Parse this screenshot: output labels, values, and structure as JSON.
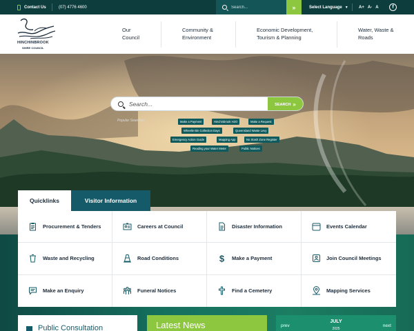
{
  "topbar": {
    "contact_label": "Contact Us",
    "phone": "(07) 4776 4600",
    "search_placeholder": "Search...",
    "search_go": "»",
    "language_label": "Select Language",
    "language_arrow": "▼",
    "text_size_large": "A+",
    "text_size_small": "A-",
    "text_size_reset": "A",
    "facebook": "f"
  },
  "logo": {
    "name": "HINCHINBROOK",
    "sub": "SHIRE COUNCIL"
  },
  "nav": [
    {
      "label": "Our\nCouncil"
    },
    {
      "label": "Community &\nEnvironment"
    },
    {
      "label": "Economic Development,\nTourism & Planning"
    },
    {
      "label": "Water, Waste &\nRoads"
    }
  ],
  "hero": {
    "search_placeholder": "Search...",
    "search_button": "SEARCH",
    "search_button_icon": "»",
    "popular_label": "Popular Searches",
    "chips": [
      "Make a Payment",
      "Hinchinbrook H2O",
      "Make a Request",
      "Wheelie Bin Collection Days",
      "Queensland Waste Levy",
      "Emergency Action Guide",
      "Mapping App",
      "No Stash Zone Register",
      "Reading your Water Meter",
      "Public Notices"
    ]
  },
  "tabs": {
    "quicklinks": "Quicklinks",
    "visitor": "Visitor Information"
  },
  "quicklinks": [
    {
      "label": "Procurement & Tenders",
      "icon": "clipboard-icon"
    },
    {
      "label": "Careers at Council",
      "icon": "id-card-icon"
    },
    {
      "label": "Disaster Information",
      "icon": "document-icon"
    },
    {
      "label": "Events Calendar",
      "icon": "calendar-icon"
    },
    {
      "label": "Waste and Recycling",
      "icon": "bin-icon"
    },
    {
      "label": "Road Conditions",
      "icon": "traffic-cone-icon"
    },
    {
      "label": "Make a Payment",
      "icon": "dollar-icon"
    },
    {
      "label": "Join Council Meetings",
      "icon": "meeting-icon"
    },
    {
      "label": "Make an Enquiry",
      "icon": "chat-icon"
    },
    {
      "label": "Funeral Notices",
      "icon": "people-icon"
    },
    {
      "label": "Find a Cemetery",
      "icon": "cross-icon"
    },
    {
      "label": "Mapping Services",
      "icon": "map-pin-icon"
    }
  ],
  "panels": {
    "consultation_title": "Public Consultation",
    "news_title": "Latest News",
    "calendar": {
      "prev": "prev",
      "next": "next",
      "month": "JULY",
      "year": "2025"
    }
  },
  "colors": {
    "topbar": "#0e3d3e",
    "accent_green": "#8dc63f",
    "teal": "#145a68",
    "band": "#15705e"
  }
}
